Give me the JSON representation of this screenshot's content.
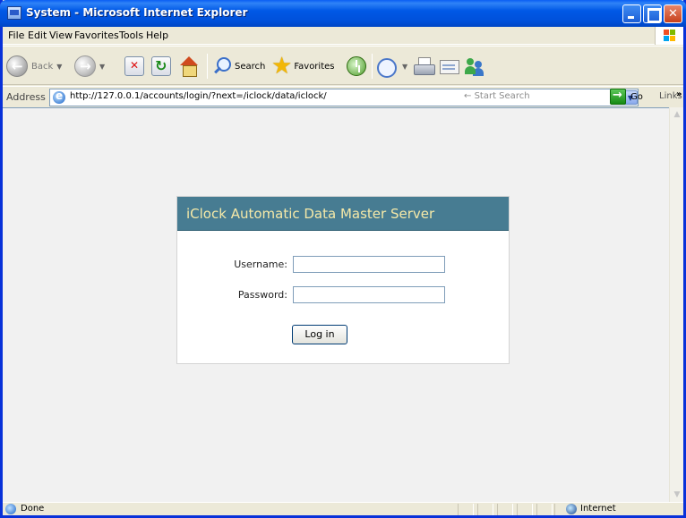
{
  "window": {
    "title": "System - Microsoft Internet Explorer"
  },
  "menu": {
    "items": [
      {
        "label": "File",
        "accel": "F"
      },
      {
        "label": "Edit",
        "accel": "E"
      },
      {
        "label": "View",
        "accel": "V"
      },
      {
        "label": "Favorites",
        "accel": "a"
      },
      {
        "label": "Tools",
        "accel": "T"
      },
      {
        "label": "Help",
        "accel": "H"
      }
    ]
  },
  "toolbar": {
    "back_label": "Back",
    "search_label": "Search",
    "favorites_label": "Favorites"
  },
  "address": {
    "label": "Address",
    "url": "http://127.0.0.1/accounts/login/?next=/iclock/data/iclock/",
    "search_placeholder": "Start Search",
    "go_label": "Go",
    "links_label": "Links"
  },
  "login": {
    "title": "iClock Automatic Data Master Server",
    "username_label": "Username:",
    "password_label": "Password:",
    "username_value": "",
    "password_value": "",
    "submit_label": "Log in"
  },
  "status": {
    "text": "Done",
    "zone": "Internet"
  },
  "colors": {
    "header_bg": "#477c92",
    "header_text": "#f5e9a8",
    "titlebar": "#0058e6"
  }
}
